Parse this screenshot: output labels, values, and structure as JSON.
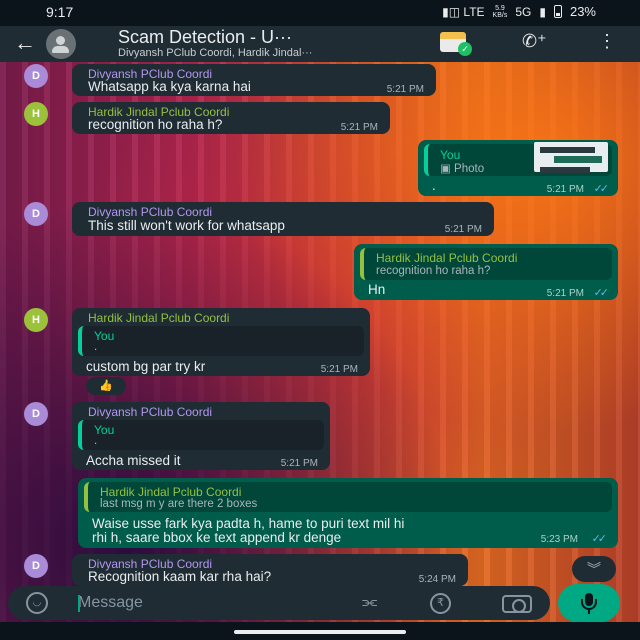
{
  "status_bar": {
    "time": "9:17",
    "icons": "▮◫ LTE",
    "speed": "5.9\nKB/s",
    "network": "5G",
    "battery": "23%"
  },
  "header": {
    "title": "Scam Detection - U···",
    "members": "Divyansh PClub Coordi, Hardik Jindal···"
  },
  "messages": [
    {
      "sender": "Divyansh PClub Coordi",
      "initial": "D",
      "text": "Whatsapp ka kya karna hai",
      "time": "5:21 PM"
    },
    {
      "sender": "Hardik Jindal Pclub Coordi",
      "initial": "H",
      "text": "recognition ho raha h?",
      "time": "5:21 PM"
    },
    {
      "quote_name": "You",
      "quote_text": "▣ Photo",
      "text": ".",
      "time": "5:21 PM"
    },
    {
      "sender": "Divyansh PClub Coordi",
      "initial": "D",
      "text": "This still won't work for whatsapp",
      "time": "5:21 PM"
    },
    {
      "quote_name": "Hardik Jindal Pclub Coordi",
      "quote_text": "recognition ho raha h?",
      "text": "Hn",
      "time": "5:21 PM"
    },
    {
      "sender": "Hardik Jindal Pclub Coordi",
      "initial": "H",
      "quote_name": "You",
      "quote_text": ".",
      "text": "custom bg par try kr",
      "time": "5:21 PM",
      "reaction": "👍"
    },
    {
      "sender": "Divyansh PClub Coordi",
      "initial": "D",
      "quote_name": "You",
      "quote_text": ".",
      "text": "Accha missed it",
      "time": "5:21 PM"
    },
    {
      "quote_name": "Hardik Jindal Pclub Coordi",
      "quote_text": "last msg m y are there 2 boxes",
      "text_line1": "Waise usse fark kya padta h, hame to puri text mil hi",
      "text_line2": "rhi h, saare bbox ke text append kr denge",
      "time": "5:23 PM"
    },
    {
      "sender": "Divyansh PClub Coordi",
      "initial": "D",
      "text": "Recognition kaam kar rha hai?",
      "time": "5:24 PM"
    }
  ],
  "ticks": "✓✓",
  "composer": {
    "placeholder": "Message",
    "rupee": "₹"
  },
  "icons": [
    "back-arrow-icon",
    "group-avatar-icon",
    "calendar-event-icon",
    "add-call-icon",
    "more-vert-icon",
    "emoji-icon",
    "attach-icon",
    "rupee-icon",
    "camera-icon",
    "mic-icon",
    "chevron-double-down-icon"
  ],
  "colors": {
    "header": "#1f2c34",
    "incoming": "#1f2c34",
    "outgoing": "#005c4b",
    "accent": "#00a884",
    "read_ticks": "#53bdeb"
  }
}
